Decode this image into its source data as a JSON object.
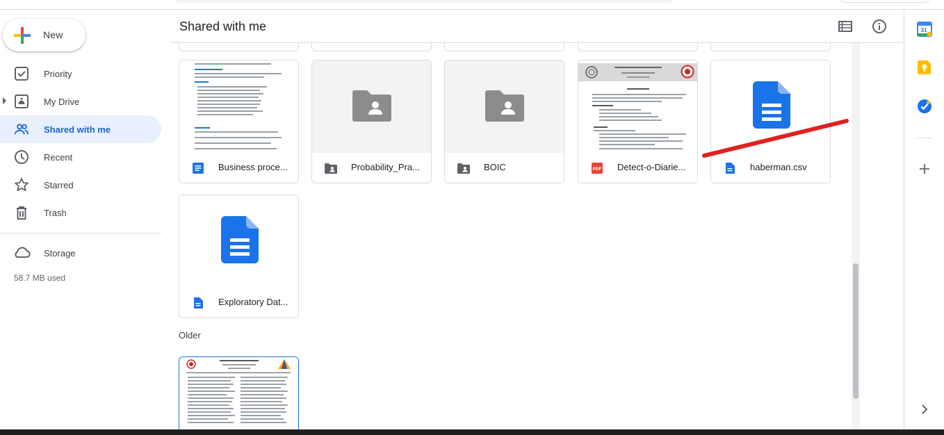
{
  "new_button": {
    "label": "New"
  },
  "sidebar": {
    "items": [
      {
        "label": "Priority"
      },
      {
        "label": "My Drive"
      },
      {
        "label": "Shared with me"
      },
      {
        "label": "Recent"
      },
      {
        "label": "Starred"
      },
      {
        "label": "Trash"
      }
    ],
    "storage_label": "Storage",
    "storage_used": "58.7 MB used"
  },
  "header": {
    "title": "Shared with me"
  },
  "files": [
    {
      "name": "Business proce...",
      "type": "google-doc"
    },
    {
      "name": "Probability_Pra...",
      "type": "shared-folder"
    },
    {
      "name": "BOIC",
      "type": "shared-folder"
    },
    {
      "name": "Detect-o-Diarie...",
      "type": "pdf"
    },
    {
      "name": "haberman.csv",
      "type": "file"
    },
    {
      "name": "Exploratory Dat...",
      "type": "google-doc"
    }
  ],
  "sections": {
    "older": "Older"
  },
  "pdf_badge": "PDF",
  "calendar_day": "31",
  "colors": {
    "accent": "#1a73e8",
    "active_bg": "#e8f0fe",
    "active_text": "#1967d2",
    "doc_blue": "#1a73e8",
    "pdf_red": "#ea4335",
    "annotation_red": "#e02020"
  }
}
